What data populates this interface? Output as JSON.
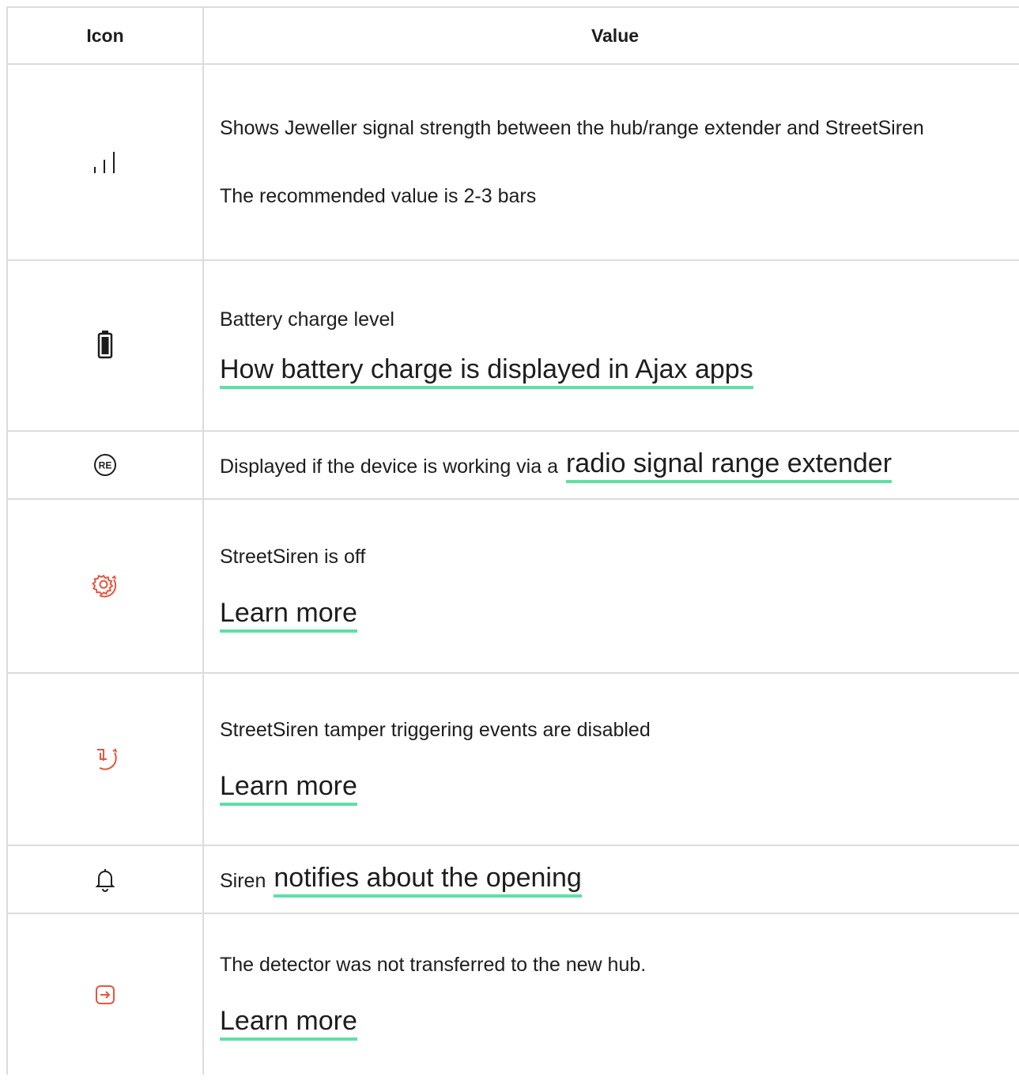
{
  "header": {
    "icon_label": "Icon",
    "value_label": "Value"
  },
  "rows": [
    {
      "icon": "signal-bars-icon",
      "lines": [
        "Shows Jeweller signal strength between the hub/range extender and StreetSiren",
        "The recommended value is 2-3 bars"
      ]
    },
    {
      "icon": "battery-icon",
      "text": "Battery charge level",
      "link": "How battery charge is displayed in Ajax apps"
    },
    {
      "icon": "range-extender-icon",
      "icon_text": "RE",
      "text": "Displayed if the device is working via a",
      "link": "radio signal range extender"
    },
    {
      "icon": "siren-off-icon",
      "text": "StreetSiren is off",
      "link": "Learn more"
    },
    {
      "icon": "tamper-disabled-icon",
      "text": "StreetSiren tamper triggering events are disabled",
      "link": "Learn more"
    },
    {
      "icon": "bell-icon",
      "text": "Siren",
      "link": "notifies about the opening"
    },
    {
      "icon": "transfer-icon",
      "text": "The detector was not transferred to the new hub.",
      "link": "Learn more"
    }
  ],
  "colors": {
    "text": "#1d1d1d",
    "border": "#dcdcdc",
    "link_underline": "#5ee0a4",
    "alert_icon": "#e5553f"
  }
}
